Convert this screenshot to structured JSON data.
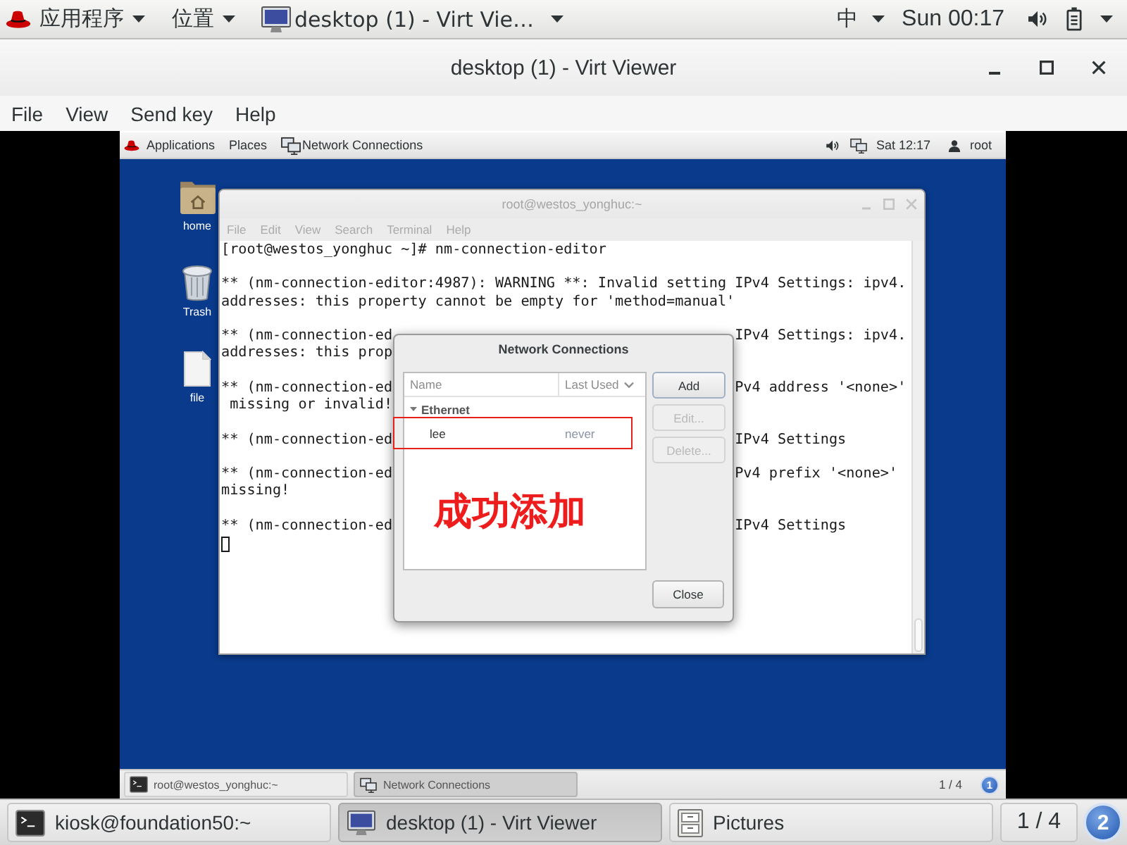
{
  "host_top_bar": {
    "menus": [
      {
        "label": "应用程序"
      },
      {
        "label": "位置"
      }
    ],
    "window_label": "desktop (1) - Virt Vie…",
    "input_method": "中",
    "clock": "Sun 00:17"
  },
  "window": {
    "title": "desktop (1) - Virt Viewer",
    "menu": [
      "File",
      "View",
      "Send key",
      "Help"
    ]
  },
  "guest": {
    "top_bar": {
      "menus": [
        "Applications",
        "Places"
      ],
      "active_app": "Network Connections",
      "clock": "Sat 12:17",
      "user": "root"
    },
    "desktop_icons": [
      {
        "kind": "folder",
        "label": "home"
      },
      {
        "kind": "trash",
        "label": "Trash"
      },
      {
        "kind": "file",
        "label": "file"
      }
    ],
    "terminal": {
      "title": "root@westos_yonghuc:~",
      "menu": [
        "File",
        "Edit",
        "View",
        "Search",
        "Terminal",
        "Help"
      ],
      "blocks": [
        {
          "lines": [
            [
              "[root@westos_yonghuc ~]# nm-connection-editor"
            ]
          ]
        },
        {
          "lines": [
            [
              "** (nm-connection-editor:4987): WARNING **: Invalid setting IPv4 Settings: ipv4."
            ],
            [
              "addresses: this property cannot be empty for 'method=manual'"
            ]
          ]
        },
        {
          "lines": [
            [
              "** (nm-connection-ed",
              "IPv4 Settings: ipv4."
            ],
            [
              "addresses: this prop"
            ]
          ]
        },
        {
          "lines": [
            [
              "** (nm-connection-ed",
              "Pv4 address '<none>'"
            ],
            [
              " missing or invalid!"
            ]
          ]
        },
        {
          "lines": [
            [
              "** (nm-connection-ed",
              "IPv4 Settings"
            ]
          ]
        },
        {
          "lines": [
            [
              "** (nm-connection-ed",
              "Pv4 prefix '<none>'"
            ],
            [
              "missing!"
            ]
          ]
        },
        {
          "lines": [
            [
              "** (nm-connection-ed",
              "IPv4 Settings"
            ]
          ]
        }
      ]
    },
    "dialog": {
      "title": "Network Connections",
      "columns": [
        "Name",
        "Last Used"
      ],
      "groups": [
        {
          "label": "Ethernet",
          "expanded": true,
          "children": [
            {
              "name": "lee",
              "last_used": "never"
            }
          ]
        }
      ],
      "buttons": [
        {
          "label": "Add",
          "disabled": false
        },
        {
          "label": "Edit...",
          "disabled": true
        },
        {
          "label": "Delete...",
          "disabled": true
        }
      ],
      "close": "Close"
    },
    "annotation": "成功添加",
    "taskbar": {
      "items": [
        {
          "kind": "terminal",
          "label": "root@westos_yonghuc:~",
          "selected": false
        },
        {
          "kind": "network",
          "label": "Network Connections",
          "selected": true
        }
      ],
      "workspace": "1 / 4",
      "badge": "1"
    }
  },
  "host_taskbar": {
    "items": [
      {
        "kind": "terminal",
        "label": "kiosk@foundation50:~",
        "selected": false
      },
      {
        "kind": "monitor",
        "label": "desktop (1) - Virt Viewer",
        "selected": true
      },
      {
        "kind": "cabinet",
        "label": "Pictures",
        "selected": false
      }
    ],
    "workspace": "1 / 4",
    "badge": "2"
  }
}
